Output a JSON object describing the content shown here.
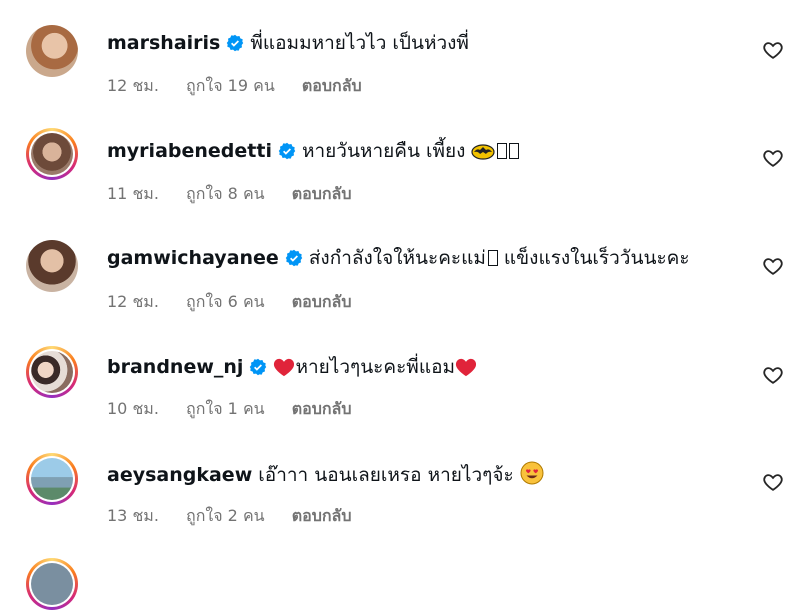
{
  "comments": [
    {
      "username": "marshairis",
      "text": "พี่แอมมหายไวไว เป็นห่วงพี่",
      "time": "12 ชม.",
      "likes": "ถูกใจ 19 คน",
      "reply": "ตอบกลับ"
    },
    {
      "username": "myriabenedetti",
      "text": "หายวันหายคืน เพี้ยง",
      "time": "11 ชม.",
      "likes": "ถูกใจ 8 คน",
      "reply": "ตอบกลับ"
    },
    {
      "username": "gamwichayanee",
      "text": "ส่งกำลังใจให้นะคะแม่",
      "text2": " แข็งแรงในเร็ววันนะคะ",
      "time": "12 ชม.",
      "likes": "ถูกใจ 6 คน",
      "reply": "ตอบกลับ"
    },
    {
      "username": "brandnew_nj",
      "text": "หายไวๆนะคะพี่แอม",
      "time": "10 ชม.",
      "likes": "ถูกใจ 1 คน",
      "reply": "ตอบกลับ"
    },
    {
      "username": "aeysangkaew",
      "text": "เอ๊าาา นอนเลยเหรอ หายไวๆจ้ะ",
      "time": "13 ชม.",
      "likes": "ถูกใจ 2 คน",
      "reply": "ตอบกลับ"
    }
  ],
  "colors": {
    "verified": "#0095f6",
    "meta": "#737373",
    "heart": "#e0245e"
  }
}
